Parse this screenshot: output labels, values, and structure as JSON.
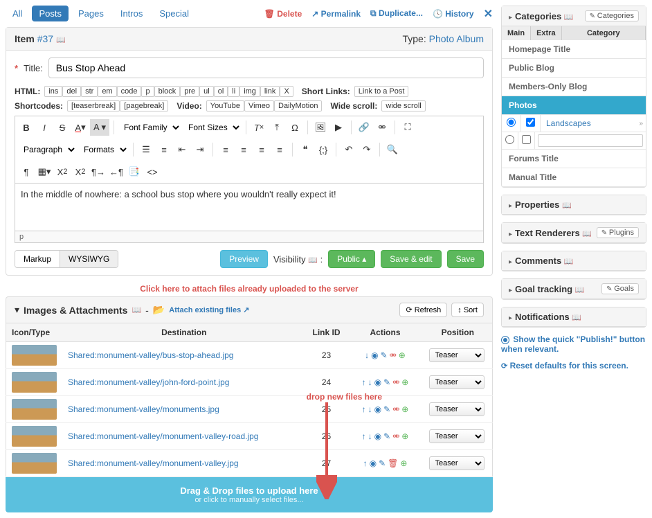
{
  "nav": {
    "all": "All",
    "posts": "Posts",
    "pages": "Pages",
    "intros": "Intros",
    "special": "Special"
  },
  "top_actions": {
    "delete": "Delete",
    "permalink": "Permalink",
    "duplicate": "Duplicate...",
    "history": "History"
  },
  "item": {
    "label": "Item",
    "num": "#37",
    "type_label": "Type:",
    "type": "Photo Album"
  },
  "title": {
    "label": "Title:",
    "value": "Bus Stop Ahead"
  },
  "html_tags": {
    "label": "HTML:",
    "tags": [
      "ins",
      "del",
      "str",
      "em",
      "code",
      "p",
      "block",
      "pre",
      "ul",
      "ol",
      "li",
      "img",
      "link",
      "X"
    ],
    "short_label": "Short Links:",
    "link_post": "Link to a Post"
  },
  "shortcodes": {
    "label": "Shortcodes:",
    "tags": [
      "[teaserbreak]",
      "[pagebreak]"
    ],
    "video_label": "Video:",
    "videos": [
      "YouTube",
      "Vimeo",
      "DailyMotion"
    ],
    "ws_label": "Wide scroll:",
    "ws": "wide scroll"
  },
  "editor": {
    "font_family": "Font Family",
    "font_sizes": "Font Sizes",
    "paragraph": "Paragraph",
    "formats": "Formats",
    "content": "In the middle of nowhere: a school bus stop where you wouldn't really expect it!",
    "status": "p"
  },
  "editor_footer": {
    "markup": "Markup",
    "wysiwyg": "WYSIWYG",
    "preview": "Preview",
    "visibility": "Visibility",
    "public": "Public",
    "save_edit": "Save & edit",
    "save": "Save"
  },
  "hints": {
    "attach_existing": "Click here to attach files already uploaded to the server",
    "drop_new": "drop new files here"
  },
  "attachments": {
    "title": "Images & Attachments",
    "attach_link": "Attach existing files",
    "refresh": "Refresh",
    "sort": "Sort",
    "cols": {
      "icon": "Icon/Type",
      "dest": "Destination",
      "linkid": "Link ID",
      "actions": "Actions",
      "position": "Position"
    },
    "rows": [
      {
        "dest": "Shared:monument-valley/bus-stop-ahead.jpg",
        "id": "23",
        "pos": "Teaser",
        "first": true
      },
      {
        "dest": "Shared:monument-valley/john-ford-point.jpg",
        "id": "24",
        "pos": "Teaser"
      },
      {
        "dest": "Shared:monument-valley/monuments.jpg",
        "id": "25",
        "pos": "Teaser"
      },
      {
        "dest": "Shared:monument-valley/monument-valley-road.jpg",
        "id": "26",
        "pos": "Teaser"
      },
      {
        "dest": "Shared:monument-valley/monument-valley.jpg",
        "id": "27",
        "pos": "Teaser",
        "last": true
      }
    ],
    "dropzone": {
      "line1": "Drag & Drop files to upload here",
      "line2": "or click to manually select files..."
    }
  },
  "sidebar": {
    "categories": {
      "title": "Categories",
      "btn": "Categories",
      "tabs": {
        "main": "Main",
        "extra": "Extra",
        "category": "Category"
      },
      "items": [
        "Homepage Title",
        "Public Blog",
        "Members-Only Blog",
        "Photos",
        "Forums Title",
        "Manual Title"
      ],
      "active_idx": 3,
      "sub": "Landscapes"
    },
    "properties": "Properties",
    "text_renderers": {
      "title": "Text Renderers",
      "btn": "Plugins"
    },
    "comments": "Comments",
    "goals": {
      "title": "Goal tracking",
      "btn": "Goals"
    },
    "notifications": "Notifications",
    "publish_hint": "Show the quick \"Publish!\" button when relevant.",
    "reset": "Reset defaults for this screen."
  }
}
